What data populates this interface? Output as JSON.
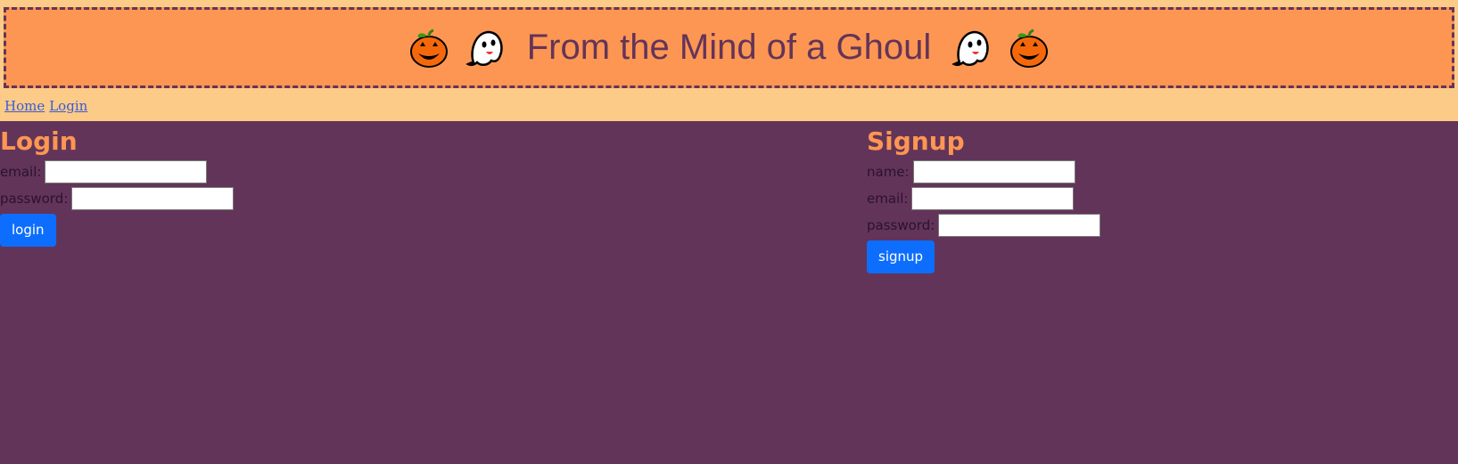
{
  "header": {
    "title": "From the Mind of a Ghoul",
    "icons": [
      "pumpkin-icon",
      "ghost-icon",
      "ghost-icon",
      "pumpkin-icon"
    ]
  },
  "nav": {
    "home": "Home",
    "login": "Login"
  },
  "login": {
    "heading": "Login",
    "email_label": "email:",
    "email_value": "",
    "password_label": "password:",
    "password_value": "",
    "button": "login"
  },
  "signup": {
    "heading": "Signup",
    "name_label": "name:",
    "name_value": "",
    "email_label": "email:",
    "email_value": "",
    "password_label": "password:",
    "password_value": "",
    "button": "signup"
  },
  "colors": {
    "page_bg": "#FCCB87",
    "header_bg": "#FC9652",
    "accent_purple": "#633459",
    "button_blue": "#0D6EFD"
  }
}
